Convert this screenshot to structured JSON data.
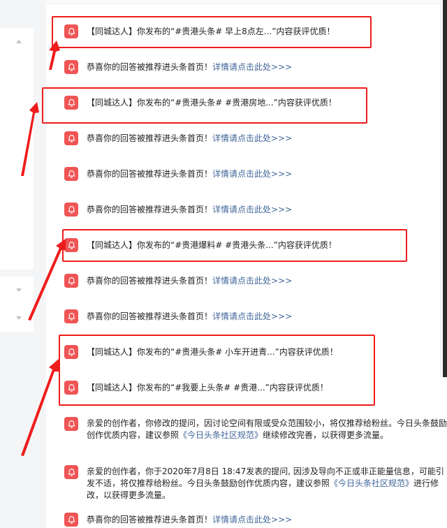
{
  "notifications": [
    {
      "text": "【同城达人】你发布的“#贵港头条# 早上8点左...”内容获评优质！",
      "link": ""
    },
    {
      "text": "恭喜你的回答被推荐进头条首页！",
      "link": "详情请点击此处>>>"
    },
    {
      "text": "【同城达人】你发布的“#贵港头条# #贵港房地...”内容获评优质！",
      "link": ""
    },
    {
      "text": "恭喜你的回答被推荐进头条首页！",
      "link": "详情请点击此处>>>"
    },
    {
      "text": "恭喜你的回答被推荐进头条首页！",
      "link": "详情请点击此处>>>"
    },
    {
      "text": "恭喜你的回答被推荐进头条首页！",
      "link": "详情请点击此处>>>"
    },
    {
      "text": "【同城达人】你发布的“#贵港爆料# #贵港头条...”内容获评优质！",
      "link": ""
    },
    {
      "text": "恭喜你的回答被推荐进头条首页！",
      "link": "详情请点击此处>>>"
    },
    {
      "text": "恭喜你的回答被推荐进头条首页！",
      "link": "详情请点击此处>>>"
    },
    {
      "text": "【同城达人】你发布的“#贵港头条# 小车开进青...”内容获评优质！",
      "link": ""
    },
    {
      "text": "【同城达人】你发布的“#我要上头条# #贵港...”内容获评优质！",
      "link": ""
    }
  ],
  "long_notices": [
    {
      "text_before": "亲爱的创作者，你修改的提问，因讨论空间有限或受众范围较小，将仅推荐给粉丝。今日头条鼓励创作优质内容，建议参照",
      "link": "《今日头条社区规范》",
      "text_after": "继续修改完善，以获得更多流量。"
    },
    {
      "text_before": "亲爱的创作者，你于2020年7月8日 18:47发表的提问, 因涉及导向不正或非正能量信息，可能引发不适，将仅推荐给粉丝。今日头条鼓励创作优质内容，建议参照",
      "link": "《今日头条社区规范》",
      "text_after": "进行修改，以获得更多流量。"
    }
  ],
  "last_notification": {
    "text": "恭喜你的回答被推荐进头条首页！",
    "link": "详情请点击此处>>>"
  },
  "icons": {
    "notification": "bell-icon"
  },
  "colors": {
    "bell_bg": "#f05454",
    "link": "#406599",
    "annotation_red": "#ef1c1c"
  }
}
